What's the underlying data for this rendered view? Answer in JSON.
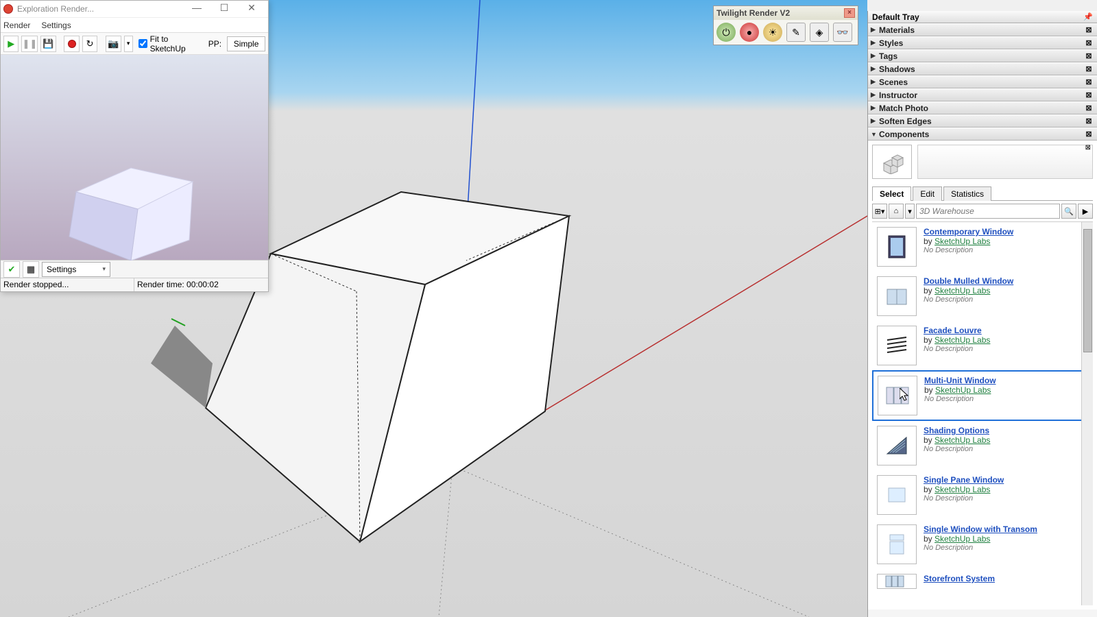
{
  "explore_window": {
    "title": "Exploration Render...",
    "menu": {
      "render": "Render",
      "settings": "Settings"
    },
    "fit_label": "Fit to SketchUp",
    "pp_label": "PP:",
    "pp_value": "Simple",
    "settings_dd": "Settings",
    "status_left": "Render stopped...",
    "status_right": "Render time: 00:00:02"
  },
  "twilight": {
    "title": "Twilight Render V2"
  },
  "tray": {
    "title": "Default Tray",
    "panels": {
      "materials": "Materials",
      "styles": "Styles",
      "tags": "Tags",
      "shadows": "Shadows",
      "scenes": "Scenes",
      "instructor": "Instructor",
      "match_photo": "Match Photo",
      "soften": "Soften Edges",
      "components": "Components"
    },
    "tabs": {
      "select": "Select",
      "edit": "Edit",
      "stats": "Statistics"
    },
    "search_placeholder": "3D Warehouse",
    "by": "by ",
    "author": "SketchUp Labs",
    "nodesc": "No Description",
    "results": [
      {
        "title": "Contemporary Window"
      },
      {
        "title": "Double Mulled Window"
      },
      {
        "title": "Facade Louvre"
      },
      {
        "title": "Multi-Unit Window"
      },
      {
        "title": "Shading Options"
      },
      {
        "title": "Single Pane Window"
      },
      {
        "title": "Single Window with Transom"
      },
      {
        "title": "Storefront System"
      }
    ]
  }
}
